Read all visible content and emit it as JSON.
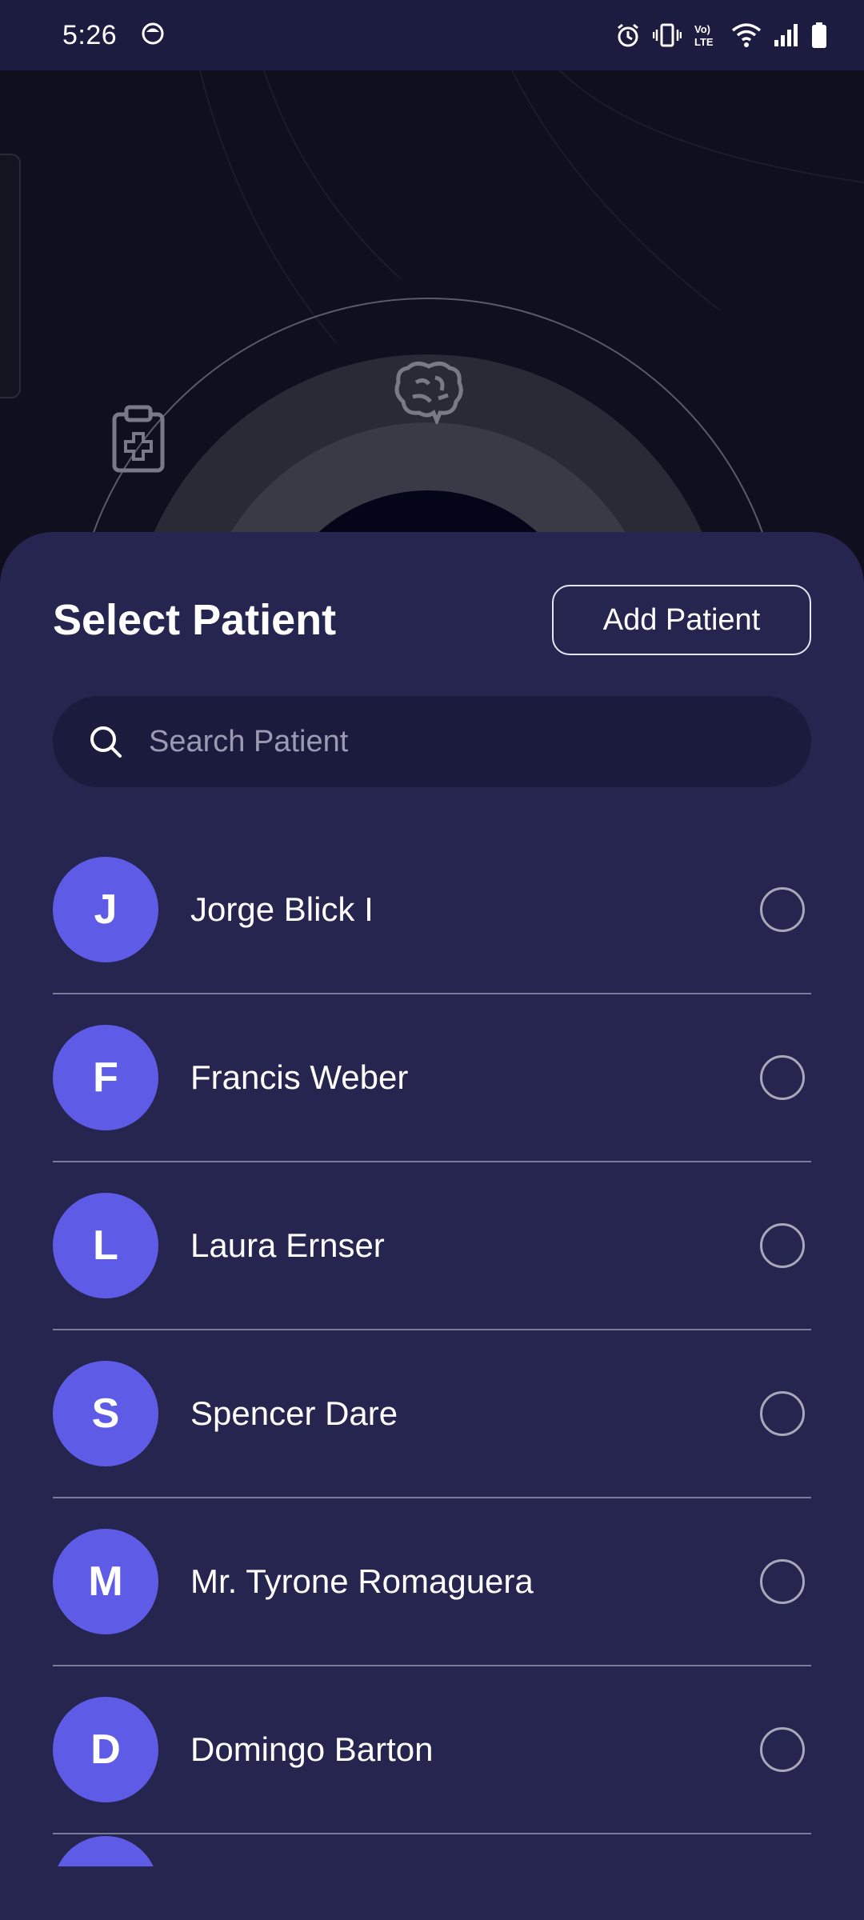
{
  "status_bar": {
    "time": "5:26",
    "icons": [
      "face-icon",
      "alarm-icon",
      "vibrate-icon",
      "volte-icon",
      "wifi-icon",
      "signal-icon",
      "battery-icon"
    ]
  },
  "sheet": {
    "title": "Select Patient",
    "add_button_label": "Add Patient",
    "search": {
      "placeholder": "Search Patient",
      "value": ""
    }
  },
  "patients": [
    {
      "initial": "J",
      "name": "Jorge Blick I",
      "selected": false
    },
    {
      "initial": "F",
      "name": "Francis Weber",
      "selected": false
    },
    {
      "initial": "L",
      "name": "Laura Ernser",
      "selected": false
    },
    {
      "initial": "S",
      "name": "Spencer Dare",
      "selected": false
    },
    {
      "initial": "M",
      "name": "Mr. Tyrone Romaguera",
      "selected": false
    },
    {
      "initial": "D",
      "name": "Domingo Barton",
      "selected": false
    }
  ],
  "colors": {
    "sheet_bg": "#262550",
    "avatar_bg": "#5e5ce6",
    "status_bar_bg": "#1c1c40",
    "search_bg": "#1b1b3e"
  }
}
